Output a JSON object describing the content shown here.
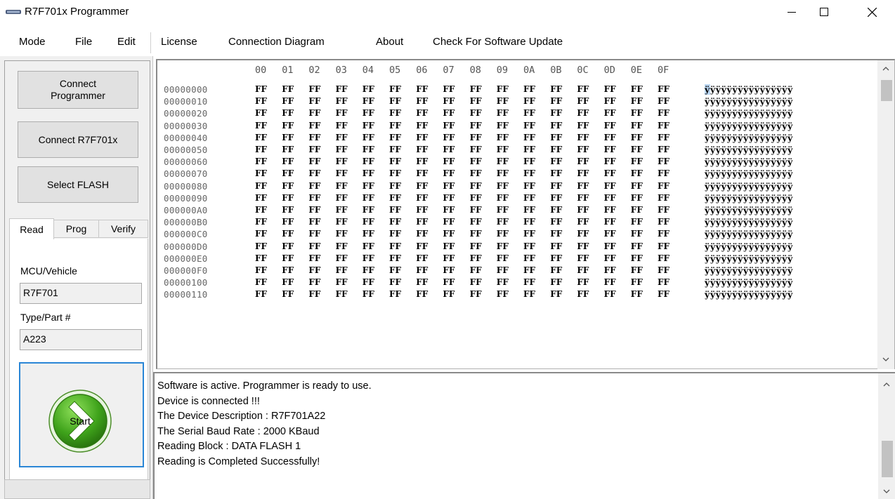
{
  "window": {
    "title": "R7F701x Programmer",
    "minimize_glyph": "—",
    "close_glyph": "✕"
  },
  "menu": [
    "Mode",
    "File",
    "Edit",
    "License",
    "Connection Diagram",
    "About",
    "Check For Software Update"
  ],
  "sidebar": {
    "connect_programmer": "Connect\nProgrammer",
    "connect_mcu": "Connect R7F701x",
    "select_flash": "Select FLASH",
    "tabs": [
      "Read",
      "Prog",
      "Verify"
    ],
    "active_tab": "Read",
    "mcu_label": "MCU/Vehicle",
    "mcu_value": "R7F701",
    "type_label": "Type/Part #",
    "type_value": "A223",
    "start_label": "Start"
  },
  "hex_view": {
    "columns": [
      "00",
      "01",
      "02",
      "03",
      "04",
      "05",
      "06",
      "07",
      "08",
      "09",
      "0A",
      "0B",
      "0C",
      "0D",
      "0E",
      "0F"
    ],
    "addresses": [
      "00000000",
      "00000010",
      "00000020",
      "00000030",
      "00000040",
      "00000050",
      "00000060",
      "00000070",
      "00000080",
      "00000090",
      "000000A0",
      "000000B0",
      "000000C0",
      "000000D0",
      "000000E0",
      "000000F0",
      "00000100",
      "00000110"
    ],
    "byte_value": "FF",
    "ascii_row": "ÿÿÿÿÿÿÿÿÿÿÿÿÿÿÿÿ"
  },
  "log": [
    "Software is active. Programmer is ready to use.",
    "Device is connected !!!",
    "The Device Description : R7F701A22",
    "The Serial Baud Rate : 2000 KBaud",
    "Reading Block : DATA FLASH 1",
    "Reading is Completed Successfully!"
  ],
  "colors": {
    "start_green": "#3fa31b",
    "focus_blue": "#2a86d6",
    "highlight": "#bcd8f4"
  },
  "icons": {
    "app": "programmer-icon",
    "start": "play-arrow-icon"
  }
}
